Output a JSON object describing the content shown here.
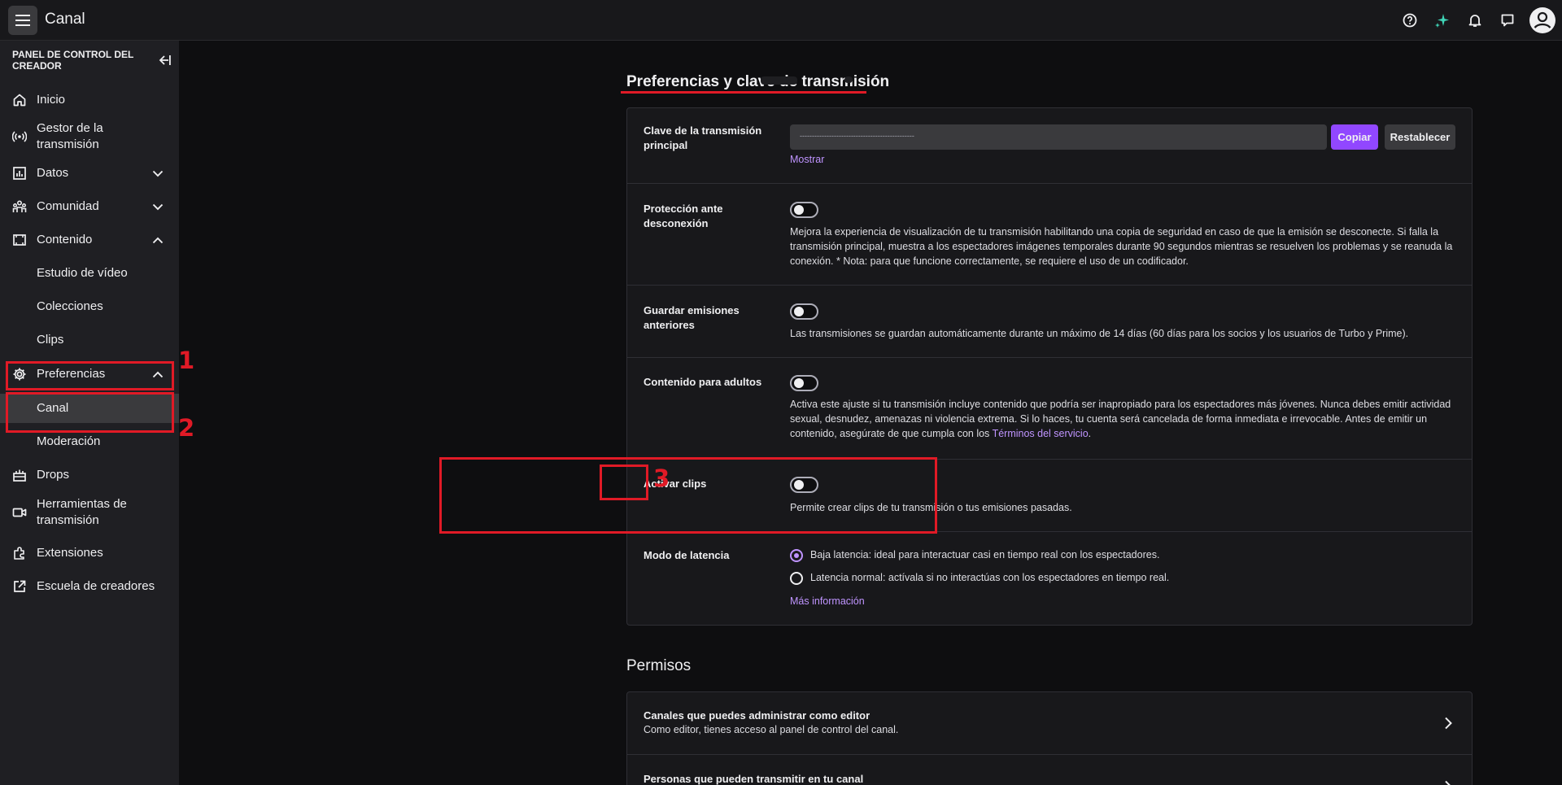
{
  "topbar": {
    "title": "Canal",
    "icons": [
      "menu-icon",
      "help-icon",
      "sparkle-icon",
      "bell-icon",
      "whisper-icon",
      "user-avatar-icon"
    ]
  },
  "sidebar": {
    "header": "PANEL DE CONTROL DEL CREADOR",
    "items": [
      {
        "label": "Inicio",
        "icon": "home-icon"
      },
      {
        "label": "Gestor de la transmisión",
        "icon": "broadcast-icon"
      },
      {
        "label": "Datos",
        "icon": "chart-icon",
        "expand": "down"
      },
      {
        "label": "Comunidad",
        "icon": "community-icon",
        "expand": "down"
      },
      {
        "label": "Contenido",
        "icon": "content-icon",
        "expand": "up"
      },
      {
        "label": "Estudio de vídeo"
      },
      {
        "label": "Colecciones"
      },
      {
        "label": "Clips"
      },
      {
        "label": "Preferencias",
        "icon": "gear-icon",
        "expand": "up"
      },
      {
        "label": "Canal",
        "active": true
      },
      {
        "label": "Moderación"
      },
      {
        "label": "Drops",
        "icon": "drops-icon"
      },
      {
        "label": "Herramientas de transmisión",
        "icon": "camera-icon"
      },
      {
        "label": "Extensiones",
        "icon": "extensions-icon"
      },
      {
        "label": "Escuela de creadores",
        "icon": "external-link-icon"
      }
    ]
  },
  "annotations": [
    "1",
    "2",
    "3"
  ],
  "main": {
    "section1_title": "Preferencias y clave de transmisión",
    "stream_key": {
      "label": "Clave de la transmisión principal",
      "value": "-----------------------------------------------",
      "copy_button": "Copiar",
      "reset_button": "Restablecer",
      "show_link": "Mostrar"
    },
    "disconnect_protection": {
      "label": "Protección ante desconexión",
      "enabled": false,
      "description": "Mejora la experiencia de visualización de tu transmisión habilitando una copia de seguridad en caso de que la emisión se desconecte. Si falla la transmisión principal, muestra a los espectadores imágenes temporales durante 90 segundos mientras se resuelven los problemas y se reanuda la conexión. * Nota: para que funcione correctamente, se requiere el uso de un codificador."
    },
    "store_past": {
      "label": "Guardar emisiones anteriores",
      "enabled": false,
      "description": "Las transmisiones se guardan automáticamente durante un máximo de 14 días (60 días para los socios y los usuarios de Turbo y Prime)."
    },
    "mature": {
      "label": "Contenido para adultos",
      "enabled": false,
      "description": "Activa este ajuste si tu transmisión incluye contenido que podría ser inapropiado para los espectadores más jóvenes. Nunca debes emitir actividad sexual, desnudez, amenazas ni violencia extrema. Si lo haces, tu cuenta será cancelada de forma inmediata e irrevocable. Antes de emitir un contenido, asegúrate de que cumpla con los",
      "link": "Términos del servicio",
      "after_link": "."
    },
    "clips": {
      "label": "Activar clips",
      "enabled": false,
      "description": "Permite crear clips de tu transmisión o tus emisiones pasadas."
    },
    "latency": {
      "label": "Modo de latencia",
      "options": [
        {
          "text": "Baja latencia: ideal para interactuar casi en tiempo real con los espectadores.",
          "checked": true
        },
        {
          "text": "Latencia normal: actívala si no interactúas con los espectadores en tiempo real.",
          "checked": false
        }
      ],
      "more_link": "Más información"
    },
    "section2_title": "Permisos",
    "permissions": [
      {
        "title": "Canales que puedes administrar como editor",
        "subtitle": "Como editor, tienes acceso al panel de control del canal."
      },
      {
        "title": "Personas que pueden transmitir en tu canal",
        "subtitle": ""
      }
    ]
  },
  "colors": {
    "accent": "#9147ff",
    "link": "#bf94ff",
    "annotation": "#e01a26"
  }
}
